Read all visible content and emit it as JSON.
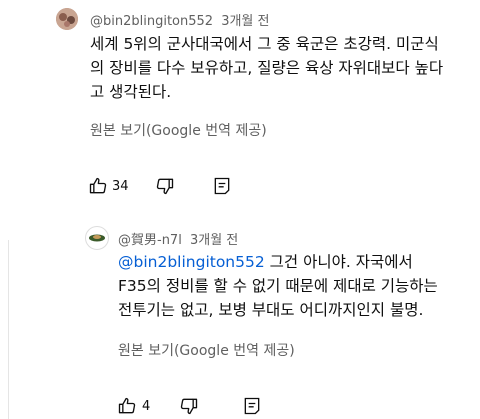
{
  "comment": {
    "author": "@bin2blingiton552",
    "age": "3개월 전",
    "text_lines": [
      "세계 5위의 군사대국에서 그 중 육군은 초강력. 미군식",
      "의 장비를 다수 보유하고, 질량은 육상 자위대보다 높다",
      "고 생각된다."
    ],
    "translate_label": "원본 보기(Google 번역 제공)",
    "likes": "34"
  },
  "reply": {
    "author": "@賀男-n7l",
    "age": "3개월 전",
    "mention": "@bin2blingiton552",
    "line1_rest": " 그건 아니야. 자국에서",
    "line2": "F35의 정비를 할 수 없기 때문에 제대로 기능하는",
    "line3": "전투기는 없고, 보병 부대도 어디까지인지 불명.",
    "translate_label": "원본 보기(Google 번역 제공)",
    "likes": "4"
  }
}
